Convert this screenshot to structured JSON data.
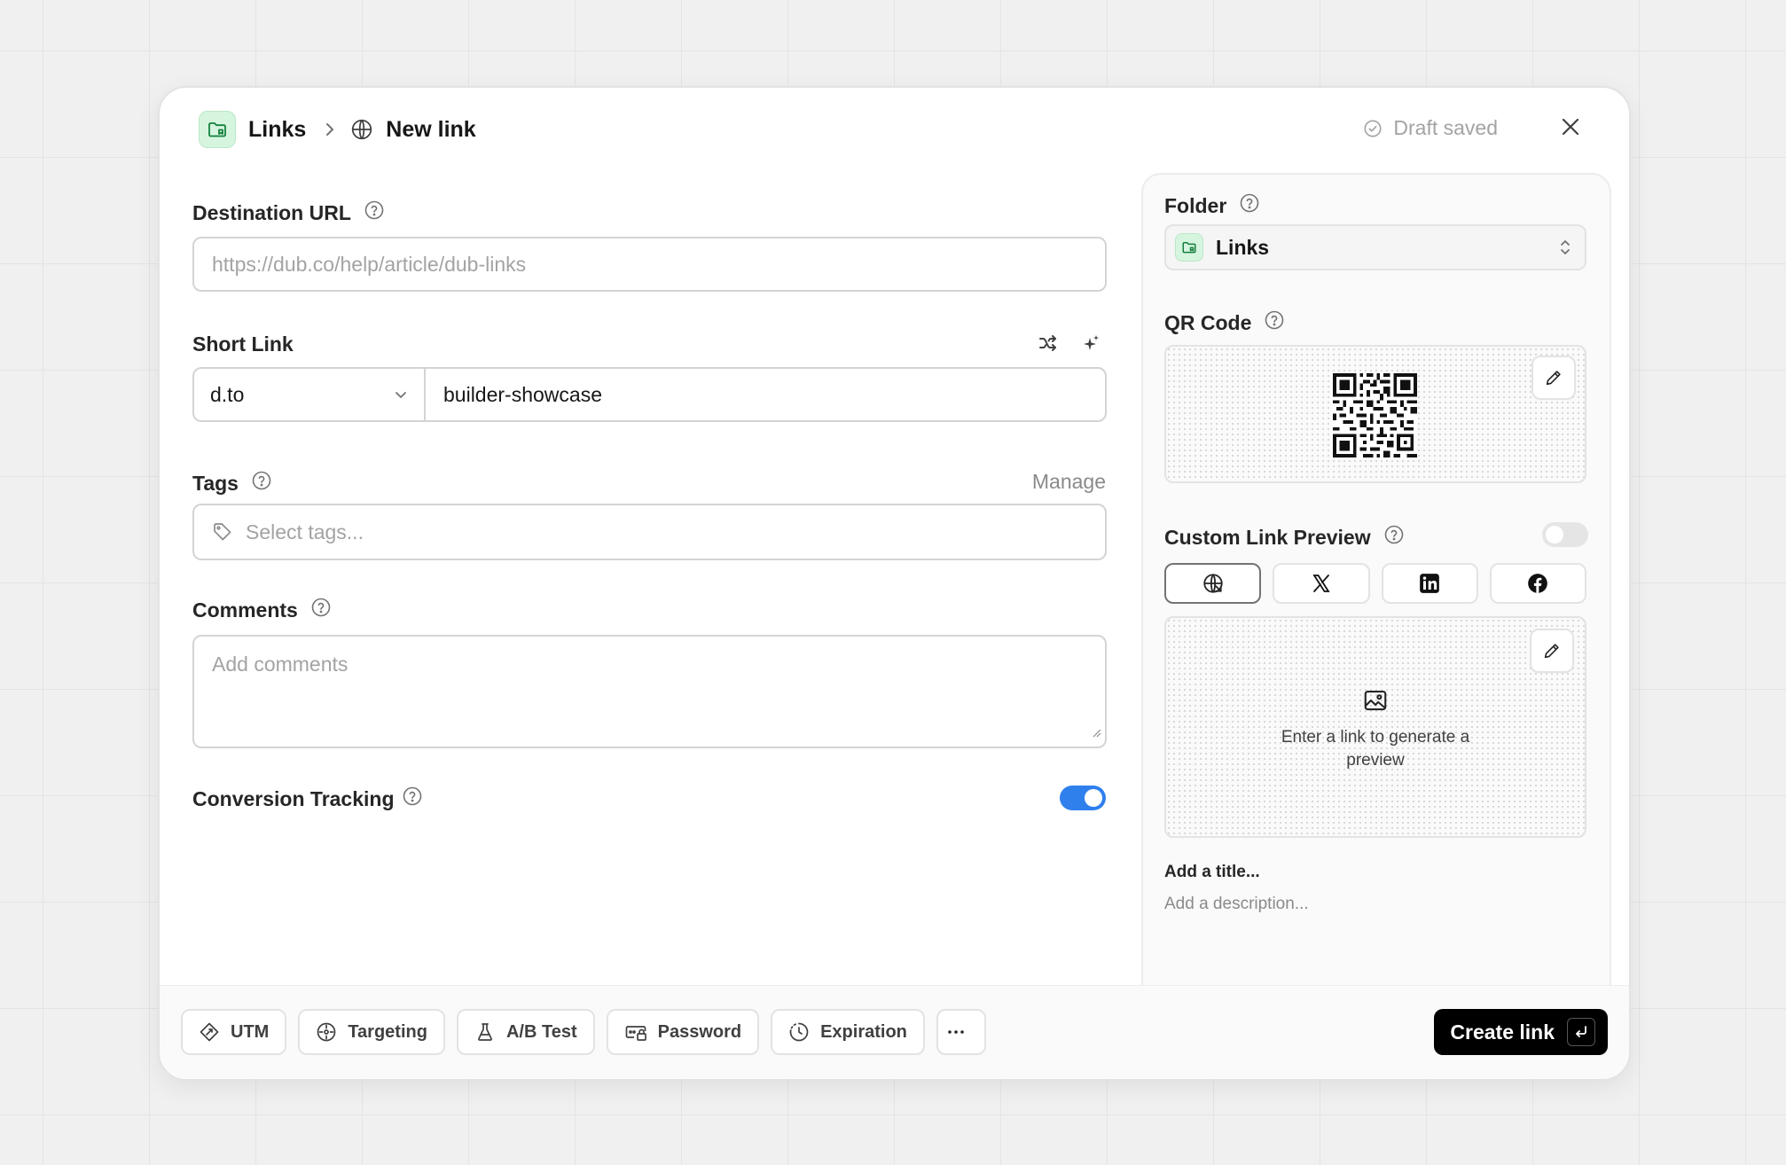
{
  "header": {
    "folder_icon": "folder-link-icon",
    "breadcrumb_folder": "Links",
    "breadcrumb_separator_icon": "chevron-right-icon",
    "page_icon": "globe-icon",
    "page_title": "New link",
    "draft_status": "Draft saved",
    "close_icon": "close-icon"
  },
  "form": {
    "destination": {
      "label": "Destination URL",
      "placeholder": "https://dub.co/help/article/dub-links"
    },
    "short_link": {
      "label": "Short Link",
      "domain": "d.to",
      "slug": "builder-showcase",
      "shuffle_icon": "shuffle-icon",
      "ai_icon": "sparkle-icon"
    },
    "tags": {
      "label": "Tags",
      "manage": "Manage",
      "placeholder": "Select tags..."
    },
    "comments": {
      "label": "Comments",
      "placeholder": "Add comments"
    },
    "conversion_tracking": {
      "label": "Conversion Tracking",
      "enabled": true
    }
  },
  "side": {
    "folder": {
      "label": "Folder",
      "value": "Links"
    },
    "qr": {
      "label": "QR Code"
    },
    "custom_preview": {
      "label": "Custom Link Preview",
      "enabled": false,
      "tabs": [
        "globe-icon",
        "x-icon",
        "linkedin-icon",
        "facebook-icon"
      ],
      "active_tab": 0,
      "empty_text": "Enter a link to generate a preview",
      "title_placeholder": "Add a title...",
      "description_placeholder": "Add a description..."
    }
  },
  "footer": {
    "buttons": [
      "UTM",
      "Targeting",
      "A/B Test",
      "Password",
      "Expiration"
    ],
    "more_icon": "more-horizontal-icon",
    "create_label": "Create link",
    "create_shortcut_icon": "enter-key-icon"
  },
  "colors": {
    "accent": "#2f80ed",
    "primary_button": "#000000",
    "folder_badge": "#d6f5df"
  }
}
